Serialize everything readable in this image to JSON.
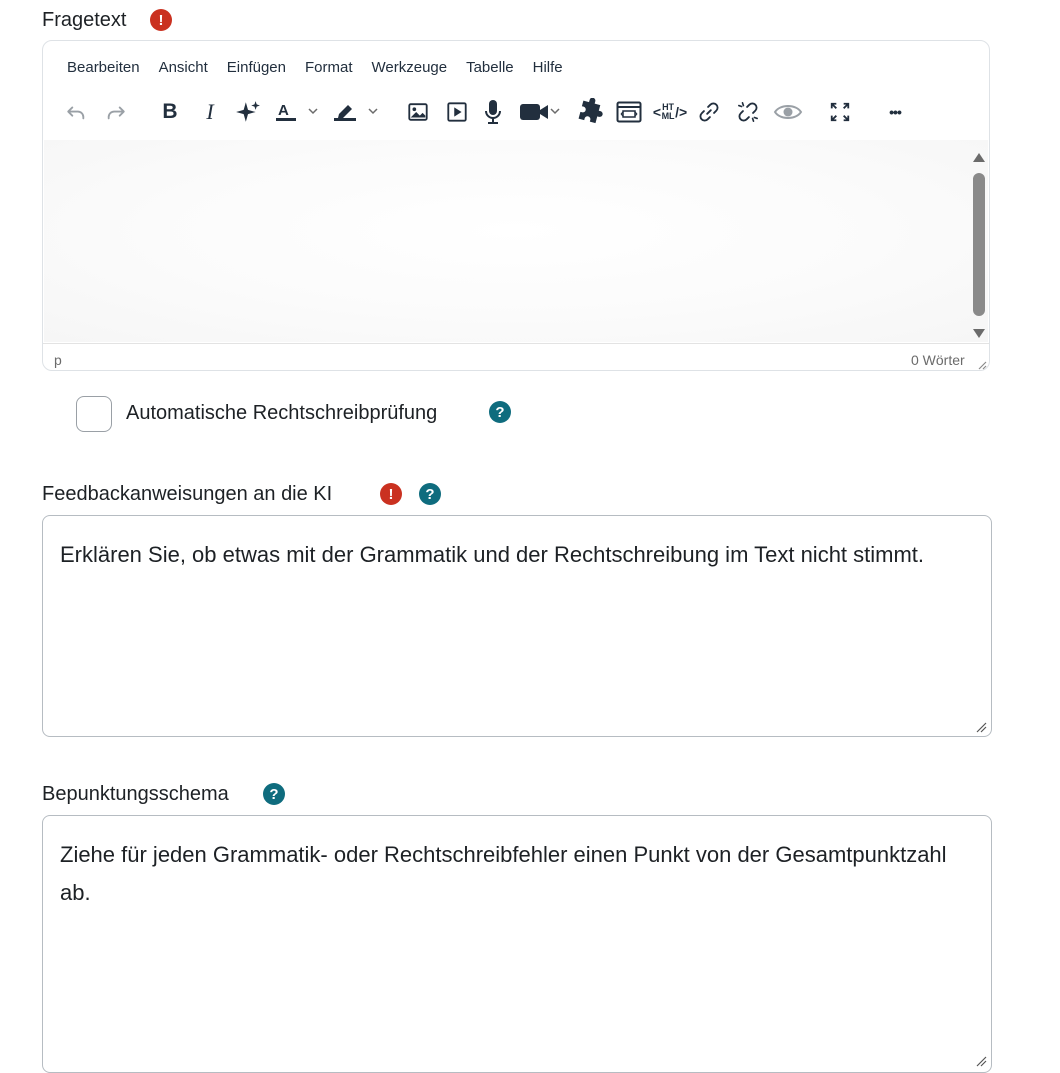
{
  "fragetext": {
    "label": "Fragetext",
    "required_icon": "exclamation-icon",
    "required_glyph": "!",
    "menu": [
      "Bearbeiten",
      "Ansicht",
      "Einfügen",
      "Format",
      "Werkzeuge",
      "Tabelle",
      "Hilfe"
    ],
    "toolbar_icons": [
      "undo-icon",
      "redo-icon",
      "bold-icon",
      "italic-icon",
      "ai-sparkle-icon",
      "text-color-icon",
      "highlight-color-icon",
      "image-icon",
      "media-icon",
      "microphone-icon",
      "video-camera-icon",
      "h5p-puzzle-icon",
      "embed-icon",
      "html-source-icon",
      "link-icon",
      "unlink-icon",
      "preview-eye-icon",
      "fullscreen-icon",
      "more-icon"
    ],
    "bold_glyph": "B",
    "italic_glyph": "I",
    "html_glyph": "HT ML",
    "more_glyph": "•••",
    "status_path": "p",
    "word_count": "0 Wörter"
  },
  "spellcheck": {
    "label": "Automatische Rechtschreibprüfung",
    "help_glyph": "?"
  },
  "feedback": {
    "label": "Feedbackanweisungen an die KI",
    "value": "Erklären Sie, ob etwas mit der Grammatik und der Rechtschreibung im Text nicht stimmt."
  },
  "scoring": {
    "label": "Bepunktungsschema",
    "value": "Ziehe für jeden Grammatik- oder Rechtschreibfehler einen Punkt von der Gesamtpunktzahl ab."
  },
  "colors": {
    "required": "#ca3120",
    "help": "#0f6c7e",
    "text": "#1d2125"
  }
}
